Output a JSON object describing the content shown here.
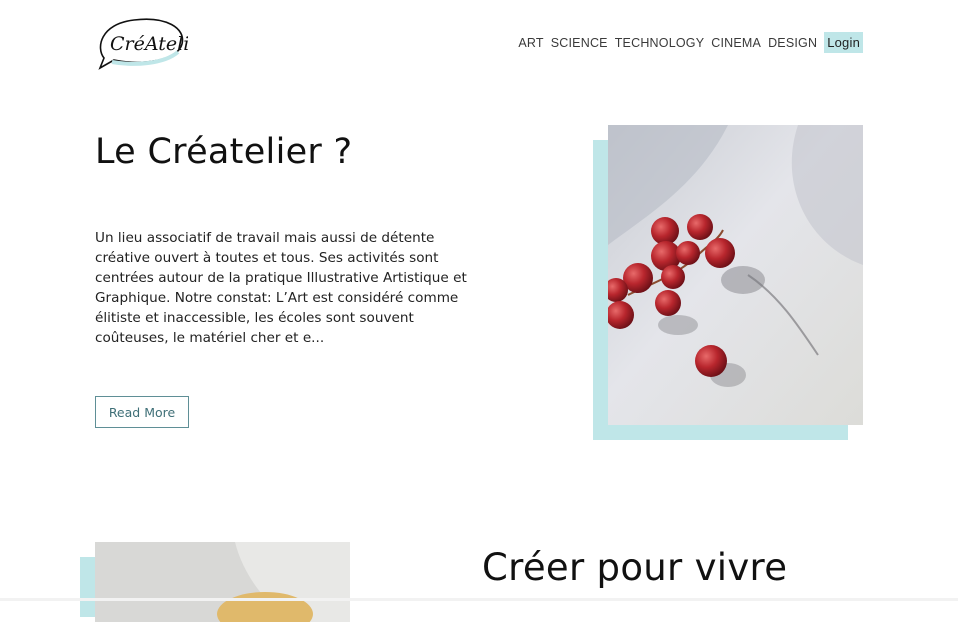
{
  "brand": {
    "logo_text": "CréAtelier",
    "accent_color": "#bfe6e8"
  },
  "nav": {
    "items": [
      "ART",
      "SCIENCE",
      "TECHNOLOGY",
      "CINEMA",
      "DESIGN"
    ],
    "login_label": "Login"
  },
  "hero": {
    "title": "Le Créatelier ?",
    "text": "Un lieu associatif de travail mais aussi de détente créative ouvert à toutes et tous. Ses activités sont centrées autour de la pratique Illustrative Artistique et Graphique. Notre constat: L’Art est considéré comme élitiste et inaccessible, les écoles sont souvent coûteuses, le matériel cher et e...",
    "button_label": "Read More",
    "image": "red-grapes-photo"
  },
  "section2": {
    "title": "Créer pour vivre",
    "image": "fruit-photo"
  }
}
